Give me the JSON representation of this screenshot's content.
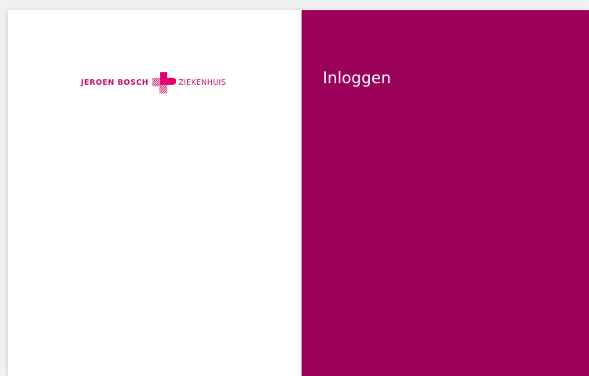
{
  "brand": {
    "name_left": "JEROEN BOSCH",
    "name_right": "ZIEKENHUIS",
    "logo_icon": "cross-heart-logo-icon",
    "color_primary": "#9b005a",
    "color_logo": "#c40f64"
  },
  "login": {
    "title": "Inloggen"
  }
}
